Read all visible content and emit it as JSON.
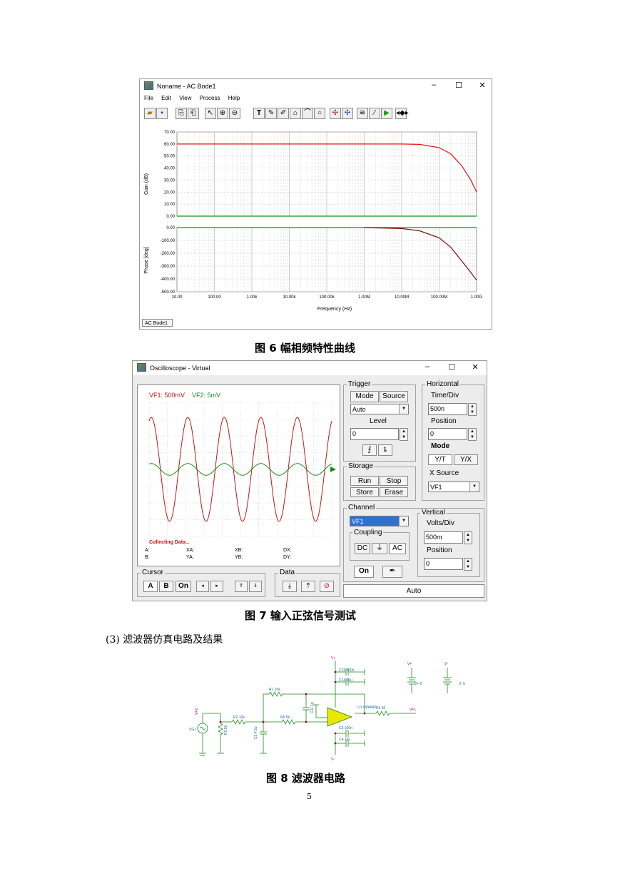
{
  "bode_window": {
    "title": "Noname - AC Bode1",
    "menu": [
      "File",
      "Edit",
      "View",
      "Process",
      "Help"
    ],
    "tab": "AC Bode1",
    "gain_plot": {
      "ylabel": "Gain (dB)",
      "ytick_labels": [
        "70.00",
        "60.00",
        "50.00",
        "40.00",
        "30.00",
        "20.00",
        "10.00",
        "0.00"
      ]
    },
    "phase_plot": {
      "ylabel": "Phase [deg]",
      "ytick_labels": [
        "0.00",
        "-100.00",
        "-200.00",
        "-300.00",
        "-400.00",
        "-500.00"
      ]
    },
    "xtick_labels": [
      "10.00",
      "100.00",
      "1.00k",
      "10.00k",
      "100.00k",
      "1.00M",
      "10.00M",
      "100.00M",
      "1.00G"
    ],
    "xlabel": "Frequency (Hz)"
  },
  "chart_data": [
    {
      "type": "line",
      "ylabel": "Gain (dB)",
      "xlabel": "Frequency (Hz)",
      "xscale": "log",
      "xlim": [
        10,
        1000000000
      ],
      "ylim": [
        0,
        70
      ],
      "grid": true,
      "series": [
        {
          "color": "#e01010",
          "x": [
            10,
            1000,
            100000,
            1000000,
            10000000,
            30000000,
            100000000,
            200000000,
            400000000,
            700000000,
            1000000000
          ],
          "y": [
            60,
            60,
            60,
            60,
            60,
            59.7,
            57,
            52,
            42,
            30,
            20
          ]
        },
        {
          "color": "#1a8a1a",
          "x": [
            10,
            1000000000
          ],
          "y": [
            0,
            0
          ]
        }
      ]
    },
    {
      "type": "line",
      "ylabel": "Phase [deg]",
      "xscale": "log",
      "xlim": [
        10,
        1000000000
      ],
      "ylim": [
        -500,
        0
      ],
      "grid": true,
      "series": [
        {
          "color": "#1a8a1a",
          "x": [
            10,
            1000000,
            10000000,
            1000000000
          ],
          "y": [
            0,
            0,
            0,
            0
          ]
        },
        {
          "color": "#7a1010",
          "x": [
            1000000,
            10000000,
            30000000,
            100000000,
            200000000,
            400000000,
            700000000,
            1000000000
          ],
          "y": [
            0,
            -8,
            -25,
            -80,
            -150,
            -260,
            -350,
            -410
          ]
        }
      ]
    },
    {
      "type": "line",
      "series": [
        {
          "name": "VF1: 500mV",
          "color": "#c01818",
          "form": "sine",
          "amplitude_div": 3.1,
          "cycles": 5
        },
        {
          "name": "VF2: 5mV",
          "color": "#1a8a1a",
          "form": "sine",
          "amplitude_div": 0.35,
          "cycles": 5
        }
      ]
    }
  ],
  "caption6": "图 6 幅相频特性曲线",
  "scope": {
    "title": "Oscilloscope - Virtual",
    "trace_labels": {
      "vf1": "VF1: 500mV",
      "vf2": "VF2: 5mV"
    },
    "status": "Collecting Data...",
    "readouts": [
      "A:",
      "XA:",
      "XB:",
      "DX:",
      "B:",
      "YA:",
      "YB:",
      "DY:"
    ],
    "trigger": {
      "title": "Trigger",
      "mode_tab": "Mode",
      "source_tab": "Source",
      "mode_value": "Auto",
      "level_label": "Level",
      "level_value": "0"
    },
    "horizontal": {
      "title": "Horizontal",
      "timediv_label": "Time/Div",
      "timediv_value": "500n",
      "position_label": "Position",
      "position_value": "0",
      "mode_label": "Mode",
      "yt": "Y/T",
      "yx": "Y/X",
      "xsource_label": "X Source",
      "xsource_value": "VF1"
    },
    "storage": {
      "title": "Storage",
      "run": "Run",
      "stop": "Stop",
      "store": "Store",
      "erase": "Erase"
    },
    "channel": {
      "title": "Channel",
      "value": "VF1",
      "coupling_label": "Coupling",
      "dc": "DC",
      "gnd": "⏚",
      "ac": "AC",
      "on": "On"
    },
    "vertical": {
      "title": "Vertical",
      "voltsdiv_label": "Volts/Div",
      "voltsdiv_value": "500m",
      "position_label": "Position",
      "position_value": "0"
    },
    "cursor": {
      "title": "Cursor",
      "a": "A",
      "b": "B",
      "on": "On"
    },
    "data_title": "Data",
    "auto": "Auto"
  },
  "caption7": "图 7 输入正弦信号测试",
  "section": "(3) 滤波器仿真电路及结果",
  "schematic": {
    "labels": {
      "c13": "C13 100n",
      "c14": "C14 10u",
      "r1": "R1 10k",
      "c11": "C11 1p",
      "r2": "R2 10k",
      "r5": "R5 5k",
      "u1": "U1 OPA842",
      "r4": "R4 50",
      "r3": "R3 50",
      "c2": "C2 4.5p",
      "c3": "C3 100n",
      "c4": "C4 10u",
      "vg1": "VG1",
      "vf2": "VF2",
      "vf1": "VF1",
      "vp": "V+",
      "vm": "V-",
      "vp2": "V+",
      "vm2": "V-",
      "vp5": "V+ 5",
      "vm5": "V- 5",
      "vm3": "V-"
    }
  },
  "caption8": "图 8 滤波器电路",
  "page_number": "5"
}
